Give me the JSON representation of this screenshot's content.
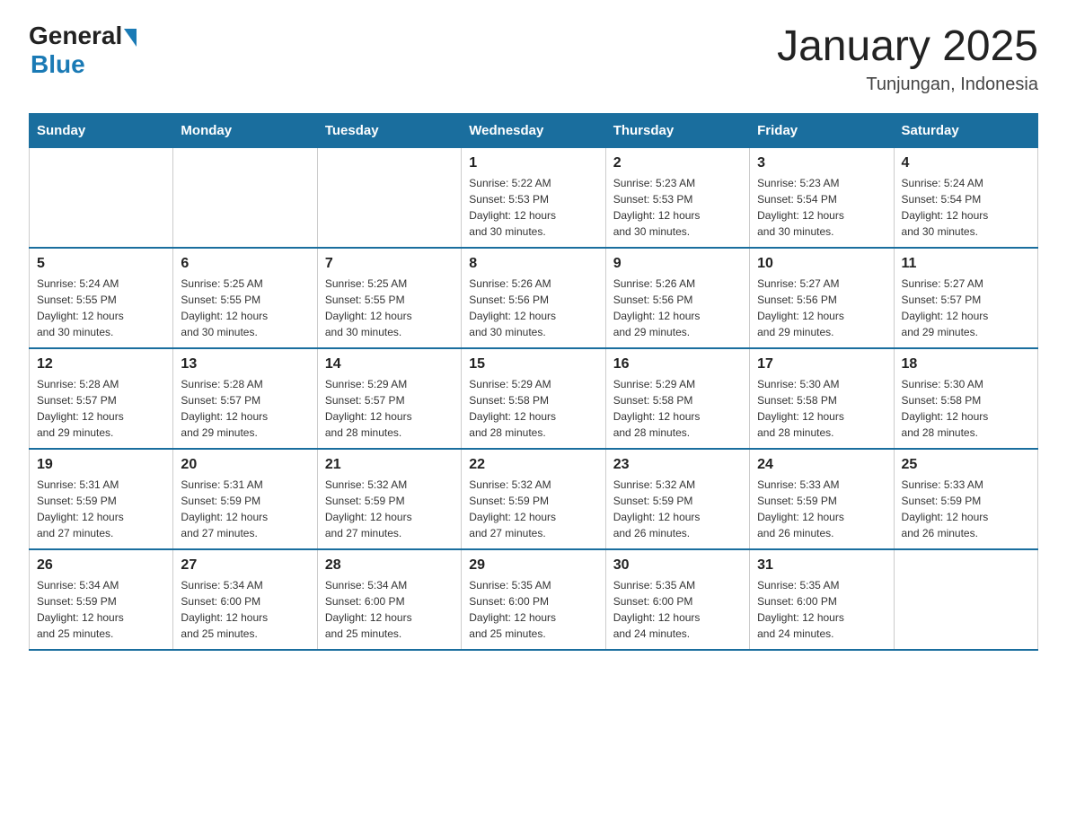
{
  "logo": {
    "general": "General",
    "blue": "Blue"
  },
  "title": "January 2025",
  "subtitle": "Tunjungan, Indonesia",
  "headers": [
    "Sunday",
    "Monday",
    "Tuesday",
    "Wednesday",
    "Thursday",
    "Friday",
    "Saturday"
  ],
  "weeks": [
    [
      {
        "day": "",
        "info": ""
      },
      {
        "day": "",
        "info": ""
      },
      {
        "day": "",
        "info": ""
      },
      {
        "day": "1",
        "info": "Sunrise: 5:22 AM\nSunset: 5:53 PM\nDaylight: 12 hours\nand 30 minutes."
      },
      {
        "day": "2",
        "info": "Sunrise: 5:23 AM\nSunset: 5:53 PM\nDaylight: 12 hours\nand 30 minutes."
      },
      {
        "day": "3",
        "info": "Sunrise: 5:23 AM\nSunset: 5:54 PM\nDaylight: 12 hours\nand 30 minutes."
      },
      {
        "day": "4",
        "info": "Sunrise: 5:24 AM\nSunset: 5:54 PM\nDaylight: 12 hours\nand 30 minutes."
      }
    ],
    [
      {
        "day": "5",
        "info": "Sunrise: 5:24 AM\nSunset: 5:55 PM\nDaylight: 12 hours\nand 30 minutes."
      },
      {
        "day": "6",
        "info": "Sunrise: 5:25 AM\nSunset: 5:55 PM\nDaylight: 12 hours\nand 30 minutes."
      },
      {
        "day": "7",
        "info": "Sunrise: 5:25 AM\nSunset: 5:55 PM\nDaylight: 12 hours\nand 30 minutes."
      },
      {
        "day": "8",
        "info": "Sunrise: 5:26 AM\nSunset: 5:56 PM\nDaylight: 12 hours\nand 30 minutes."
      },
      {
        "day": "9",
        "info": "Sunrise: 5:26 AM\nSunset: 5:56 PM\nDaylight: 12 hours\nand 29 minutes."
      },
      {
        "day": "10",
        "info": "Sunrise: 5:27 AM\nSunset: 5:56 PM\nDaylight: 12 hours\nand 29 minutes."
      },
      {
        "day": "11",
        "info": "Sunrise: 5:27 AM\nSunset: 5:57 PM\nDaylight: 12 hours\nand 29 minutes."
      }
    ],
    [
      {
        "day": "12",
        "info": "Sunrise: 5:28 AM\nSunset: 5:57 PM\nDaylight: 12 hours\nand 29 minutes."
      },
      {
        "day": "13",
        "info": "Sunrise: 5:28 AM\nSunset: 5:57 PM\nDaylight: 12 hours\nand 29 minutes."
      },
      {
        "day": "14",
        "info": "Sunrise: 5:29 AM\nSunset: 5:57 PM\nDaylight: 12 hours\nand 28 minutes."
      },
      {
        "day": "15",
        "info": "Sunrise: 5:29 AM\nSunset: 5:58 PM\nDaylight: 12 hours\nand 28 minutes."
      },
      {
        "day": "16",
        "info": "Sunrise: 5:29 AM\nSunset: 5:58 PM\nDaylight: 12 hours\nand 28 minutes."
      },
      {
        "day": "17",
        "info": "Sunrise: 5:30 AM\nSunset: 5:58 PM\nDaylight: 12 hours\nand 28 minutes."
      },
      {
        "day": "18",
        "info": "Sunrise: 5:30 AM\nSunset: 5:58 PM\nDaylight: 12 hours\nand 28 minutes."
      }
    ],
    [
      {
        "day": "19",
        "info": "Sunrise: 5:31 AM\nSunset: 5:59 PM\nDaylight: 12 hours\nand 27 minutes."
      },
      {
        "day": "20",
        "info": "Sunrise: 5:31 AM\nSunset: 5:59 PM\nDaylight: 12 hours\nand 27 minutes."
      },
      {
        "day": "21",
        "info": "Sunrise: 5:32 AM\nSunset: 5:59 PM\nDaylight: 12 hours\nand 27 minutes."
      },
      {
        "day": "22",
        "info": "Sunrise: 5:32 AM\nSunset: 5:59 PM\nDaylight: 12 hours\nand 27 minutes."
      },
      {
        "day": "23",
        "info": "Sunrise: 5:32 AM\nSunset: 5:59 PM\nDaylight: 12 hours\nand 26 minutes."
      },
      {
        "day": "24",
        "info": "Sunrise: 5:33 AM\nSunset: 5:59 PM\nDaylight: 12 hours\nand 26 minutes."
      },
      {
        "day": "25",
        "info": "Sunrise: 5:33 AM\nSunset: 5:59 PM\nDaylight: 12 hours\nand 26 minutes."
      }
    ],
    [
      {
        "day": "26",
        "info": "Sunrise: 5:34 AM\nSunset: 5:59 PM\nDaylight: 12 hours\nand 25 minutes."
      },
      {
        "day": "27",
        "info": "Sunrise: 5:34 AM\nSunset: 6:00 PM\nDaylight: 12 hours\nand 25 minutes."
      },
      {
        "day": "28",
        "info": "Sunrise: 5:34 AM\nSunset: 6:00 PM\nDaylight: 12 hours\nand 25 minutes."
      },
      {
        "day": "29",
        "info": "Sunrise: 5:35 AM\nSunset: 6:00 PM\nDaylight: 12 hours\nand 25 minutes."
      },
      {
        "day": "30",
        "info": "Sunrise: 5:35 AM\nSunset: 6:00 PM\nDaylight: 12 hours\nand 24 minutes."
      },
      {
        "day": "31",
        "info": "Sunrise: 5:35 AM\nSunset: 6:00 PM\nDaylight: 12 hours\nand 24 minutes."
      },
      {
        "day": "",
        "info": ""
      }
    ]
  ]
}
